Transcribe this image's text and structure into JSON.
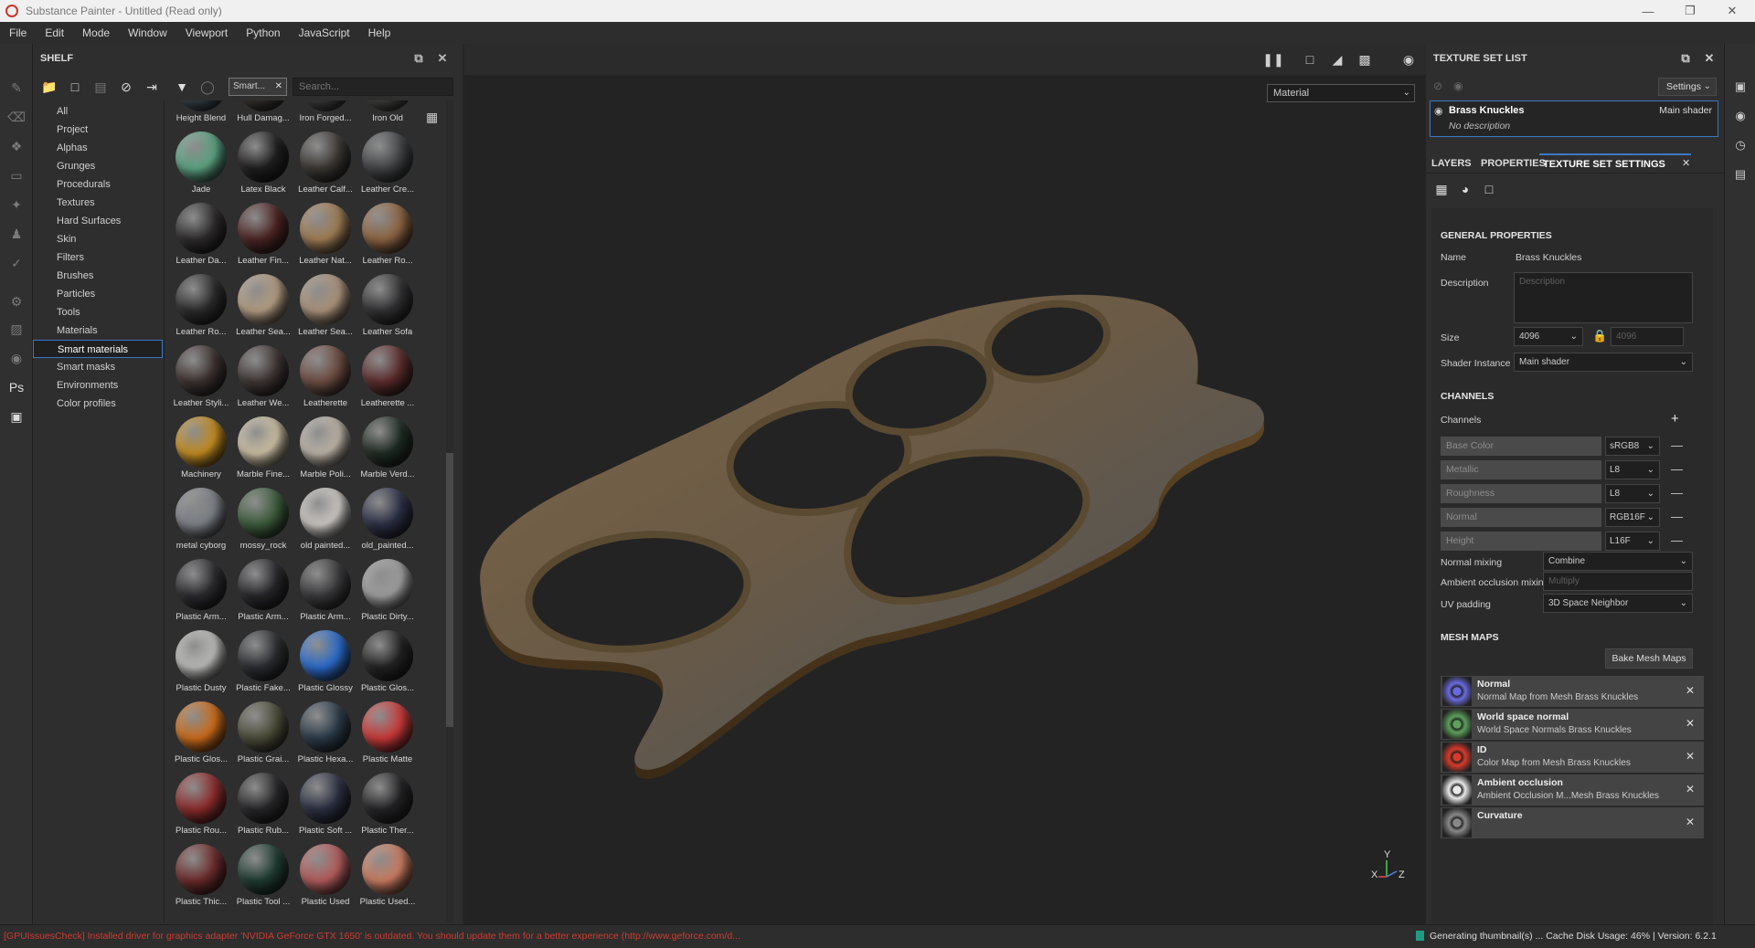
{
  "window": {
    "title": "Substance Painter - Untitled (Read only)"
  },
  "menu": [
    "File",
    "Edit",
    "Mode",
    "Window",
    "Viewport",
    "Python",
    "JavaScript",
    "Help"
  ],
  "shelf": {
    "title": "SHELF",
    "filter_tag": "Smart...",
    "search_placeholder": "Search...",
    "categories": [
      "All",
      "Project",
      "Alphas",
      "Grunges",
      "Procedurals",
      "Textures",
      "Hard Surfaces",
      "Skin",
      "Filters",
      "Brushes",
      "Particles",
      "Tools",
      "Materials",
      "Smart materials",
      "Smart masks",
      "Environments",
      "Color profiles"
    ],
    "selected_category": "Smart materials",
    "items": [
      {
        "label": "Height Blend",
        "color": "#3a4a55"
      },
      {
        "label": "Hull Damag...",
        "color": "#3a3530"
      },
      {
        "label": "Iron Forged...",
        "color": "#444444"
      },
      {
        "label": "Iron Old",
        "color": "#4a4a48"
      },
      {
        "label": "Jade",
        "color": "#5aa080"
      },
      {
        "label": "Latex Black",
        "color": "#1e1e1e"
      },
      {
        "label": "Leather Calf...",
        "color": "#3a3632"
      },
      {
        "label": "Leather Cre...",
        "color": "#404244"
      },
      {
        "label": "Leather Da...",
        "color": "#2c2a2a"
      },
      {
        "label": "Leather Fin...",
        "color": "#4a2322"
      },
      {
        "label": "Leather Nat...",
        "color": "#9c7a52"
      },
      {
        "label": "Leather Ro...",
        "color": "#8a6240"
      },
      {
        "label": "Leather Ro...",
        "color": "#2a2a2a"
      },
      {
        "label": "Leather Sea...",
        "color": "#b09a80"
      },
      {
        "label": "Leather Sea...",
        "color": "#a89078"
      },
      {
        "label": "Leather Sofa",
        "color": "#303032"
      },
      {
        "label": "Leather Styli...",
        "color": "#3a302e"
      },
      {
        "label": "Leather We...",
        "color": "#3c3432"
      },
      {
        "label": "Leatherette",
        "color": "#6a4a40"
      },
      {
        "label": "Leatherette ...",
        "color": "#5a2a2a"
      },
      {
        "label": "Machinery",
        "color": "#c08a20"
      },
      {
        "label": "Marble Fine...",
        "color": "#c8bca0"
      },
      {
        "label": "Marble Poli...",
        "color": "#b8b0a4"
      },
      {
        "label": "Marble Verd...",
        "color": "#1e2a22"
      },
      {
        "label": "metal cyborg",
        "color": "#7a7e84"
      },
      {
        "label": "mossy_rock",
        "color": "#3a5a3a"
      },
      {
        "label": "old painted...",
        "color": "#c8c4c0"
      },
      {
        "label": "old_painted...",
        "color": "#2a2e44"
      },
      {
        "label": "Plastic Arm...",
        "color": "#2a2a2e"
      },
      {
        "label": "Plastic Arm...",
        "color": "#26262a"
      },
      {
        "label": "Plastic Arm...",
        "color": "#38383a"
      },
      {
        "label": "Plastic Dirty...",
        "color": "#9c9c9c"
      },
      {
        "label": "Plastic Dusty",
        "color": "#b8b8b6"
      },
      {
        "label": "Plastic Fake...",
        "color": "#2a2c30"
      },
      {
        "label": "Plastic Glossy",
        "color": "#2a6ac8"
      },
      {
        "label": "Plastic Glos...",
        "color": "#222222"
      },
      {
        "label": "Plastic Glos...",
        "color": "#c86a1a"
      },
      {
        "label": "Plastic Grai...",
        "color": "#4a4a38"
      },
      {
        "label": "Plastic Hexa...",
        "color": "#2a3a48"
      },
      {
        "label": "Plastic Matte",
        "color": "#c83838"
      },
      {
        "label": "Plastic Rou...",
        "color": "#8a2a2a"
      },
      {
        "label": "Plastic Rub...",
        "color": "#262628"
      },
      {
        "label": "Plastic Soft ...",
        "color": "#2a2e40"
      },
      {
        "label": "Plastic Ther...",
        "color": "#222224"
      },
      {
        "label": "Plastic Thic...",
        "color": "#6a2a2a"
      },
      {
        "label": "Plastic Tool ...",
        "color": "#1e3a30"
      },
      {
        "label": "Plastic Used",
        "color": "#b05a5a"
      },
      {
        "label": "Plastic Used...",
        "color": "#c87a60"
      }
    ]
  },
  "viewport": {
    "material_mode": "Material",
    "axis": {
      "y": "Y",
      "x": "X",
      "z": "Z"
    }
  },
  "texture_set_list": {
    "title": "TEXTURE SET LIST",
    "settings_label": "Settings",
    "set": {
      "name": "Brass Knuckles",
      "shader": "Main shader",
      "description": "No description"
    }
  },
  "tabs": {
    "layers": "LAYERS",
    "properties": "PROPERTIES",
    "tss": "TEXTURE SET SETTINGS"
  },
  "tss": {
    "general_title": "GENERAL PROPERTIES",
    "name_label": "Name",
    "name_value": "Brass Knuckles",
    "desc_label": "Description",
    "desc_placeholder": "Description",
    "size_label": "Size",
    "size_value": "4096",
    "size_linked": "4096",
    "shader_label": "Shader Instance",
    "shader_value": "Main shader",
    "channels_title": "CHANNELS",
    "channels_label": "Channels",
    "channels": [
      {
        "name": "Base Color",
        "format": "sRGB8"
      },
      {
        "name": "Metallic",
        "format": "L8"
      },
      {
        "name": "Roughness",
        "format": "L8"
      },
      {
        "name": "Normal",
        "format": "RGB16F"
      },
      {
        "name": "Height",
        "format": "L16F"
      }
    ],
    "normal_mixing_label": "Normal mixing",
    "normal_mixing_value": "Combine",
    "ao_mixing_label": "Ambient occlusion mixing",
    "ao_mixing_value": "Multiply",
    "uv_padding_label": "UV padding",
    "uv_padding_value": "3D Space Neighbor",
    "mesh_maps_title": "MESH MAPS",
    "bake_label": "Bake Mesh Maps",
    "mesh_maps": [
      {
        "title": "Normal",
        "subtitle": "Normal Map from Mesh Brass Knuckles",
        "color": "#6a6ae0"
      },
      {
        "title": "World space normal",
        "subtitle": "World Space Normals Brass Knuckles",
        "color": "#5aa05a"
      },
      {
        "title": "ID",
        "subtitle": "Color Map from Mesh Brass Knuckles",
        "color": "#d83a2a"
      },
      {
        "title": "Ambient occlusion",
        "subtitle": "Ambient Occlusion M...Mesh Brass Knuckles",
        "color": "#e8e8e8"
      },
      {
        "title": "Curvature",
        "subtitle": "",
        "color": "#888888"
      }
    ]
  },
  "status": {
    "message": "[GPUIssuesCheck] Installed driver for graphics adapter 'NVIDIA GeForce GTX 1650' is outdated. You should update them for a better experience (http://www.geforce.com/d...",
    "right": "Generating thumbnail(s) ...     Cache Disk Usage:   46% | Version: 6.2.1"
  }
}
